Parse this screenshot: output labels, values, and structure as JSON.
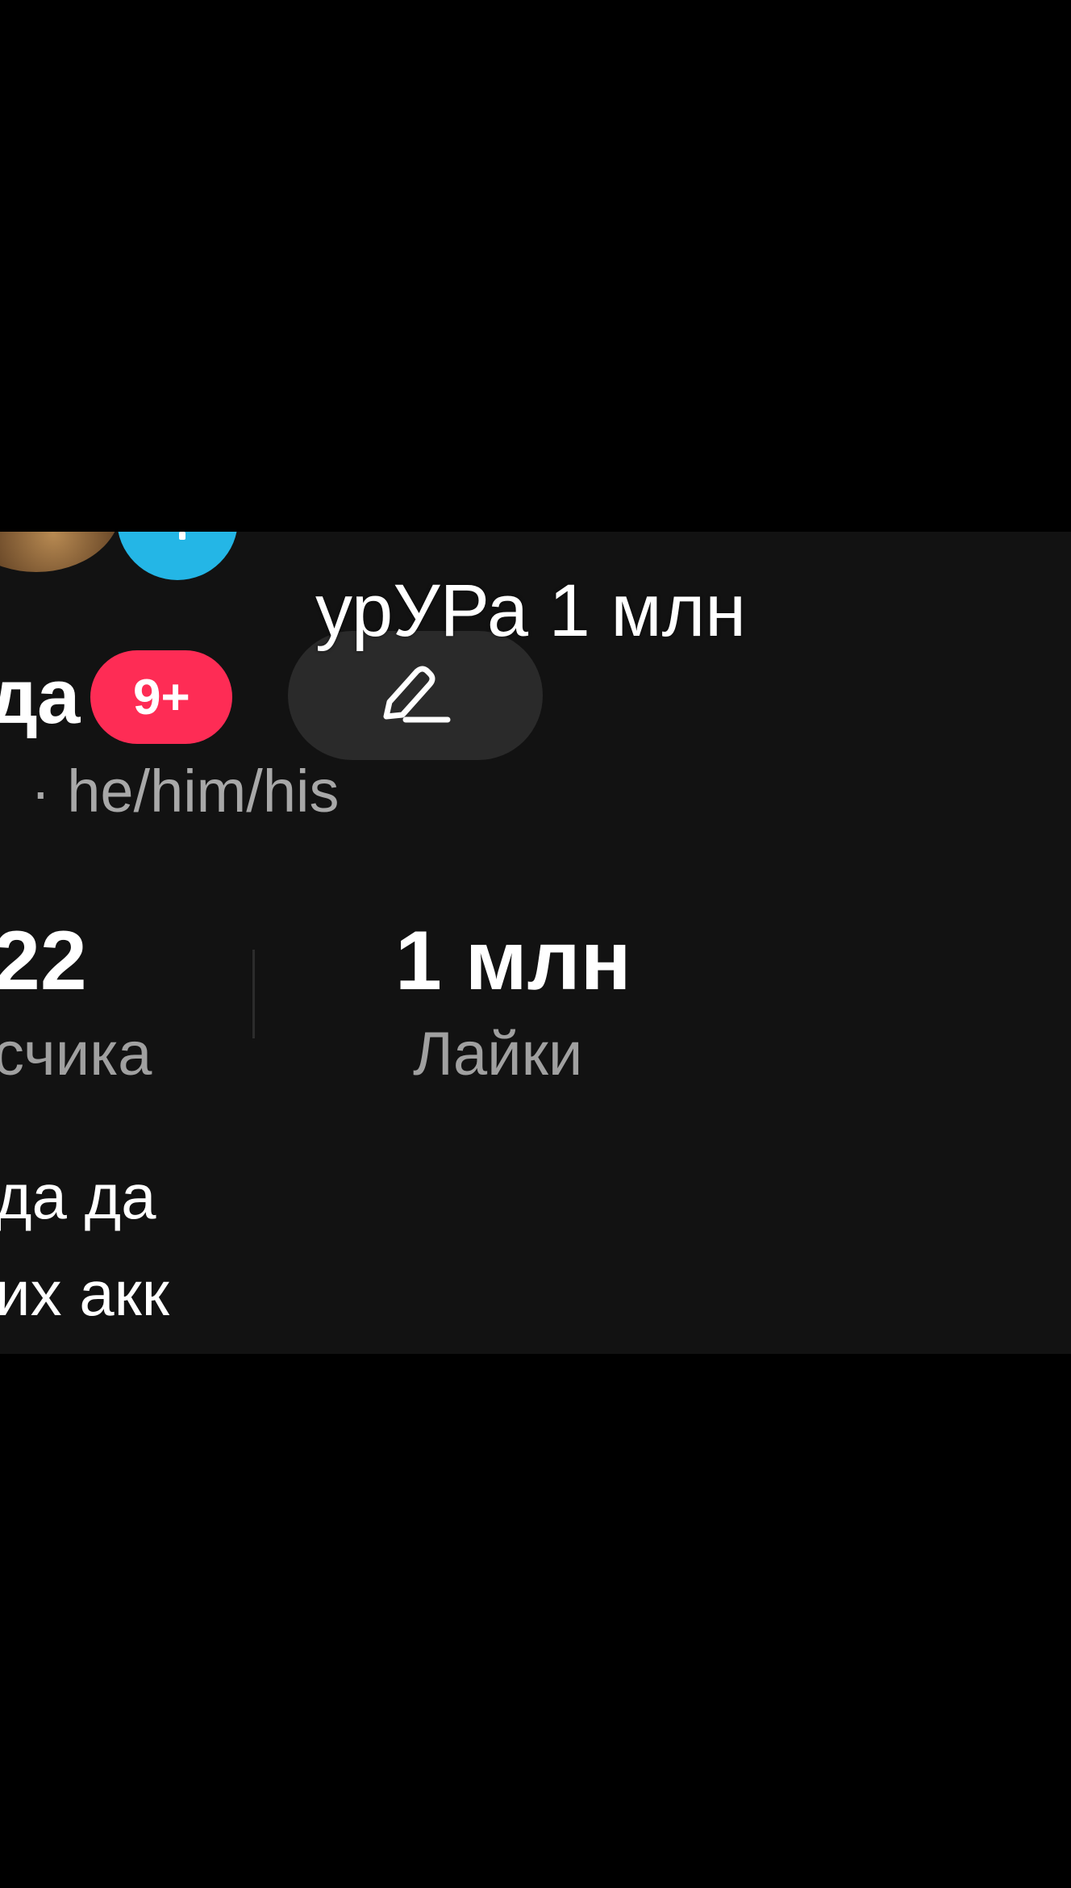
{
  "overlay": {
    "caption": "урУРа 1 млн"
  },
  "profile": {
    "name_fragment": "да",
    "notification_badge": "9+",
    "pronouns": "· he/him/his"
  },
  "stats": {
    "followers": {
      "value": "22",
      "label": "счика"
    },
    "likes": {
      "value": "1 млн",
      "label": "Лайки"
    }
  },
  "bio": {
    "line1": "да да",
    "line2": "их акк"
  },
  "icons": {
    "edit": "pencil-icon"
  },
  "colors": {
    "background": "#000000",
    "panel": "#121212",
    "badge": "#fe2c55",
    "accent": "#24b6e6"
  }
}
